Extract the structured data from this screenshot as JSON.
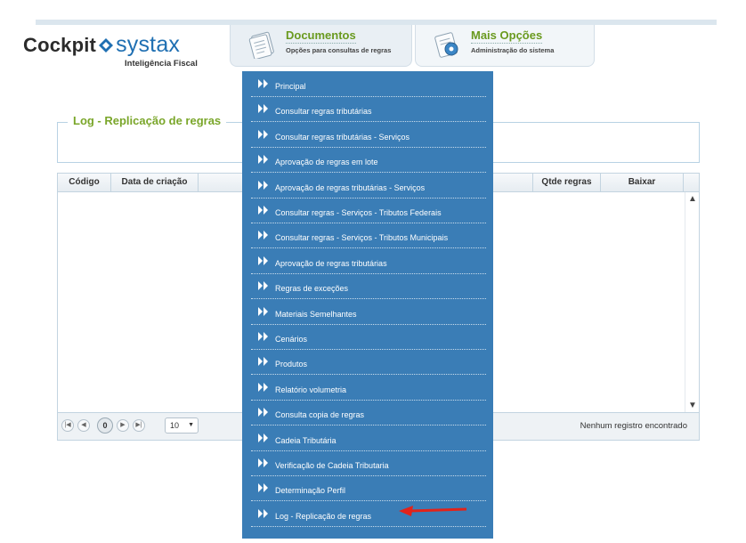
{
  "logo": {
    "brand_left": "Cockpit",
    "brand_right": "systax",
    "tagline": "Inteligência Fiscal"
  },
  "nav": {
    "documentos": {
      "title": "Documentos",
      "subtitle": "Opções para consultas de regras"
    },
    "mais_opcoes": {
      "title": "Mais Opções",
      "subtitle": "Administração do sistema"
    }
  },
  "page": {
    "title": "Log - Replicação de regras"
  },
  "grid": {
    "columns": [
      "Código",
      "Data de criação",
      "Qtde regras",
      "Baixar"
    ],
    "current_page": "0",
    "page_size": "10",
    "empty_message": "Nenhum registro encontrado"
  },
  "menu": {
    "items": [
      "Principal",
      "Consultar regras tributárias",
      "Consultar regras tributárias - Serviços",
      "Aprovação de regras em lote",
      "Aprovação de regras tributárias - Serviços",
      "Consultar regras - Serviços - Tributos Federais",
      "Consultar regras - Serviços - Tributos Municipais",
      "Aprovação de regras tributárias",
      "Regras de exceções",
      "Materiais Semelhantes",
      "Cenários",
      "Produtos",
      "Relatório volumetria",
      "Consulta copia de regras",
      "Cadeia Tributária",
      "Verificação de Cadeia Tributaria",
      "Determinação Perfil",
      "Log - Replicação de regras"
    ]
  },
  "colors": {
    "menu_bg": "#3a7db6",
    "accent_green": "#7aa62a",
    "brand_blue": "#1f6fb2",
    "annotation_arrow": "#e2231a"
  }
}
